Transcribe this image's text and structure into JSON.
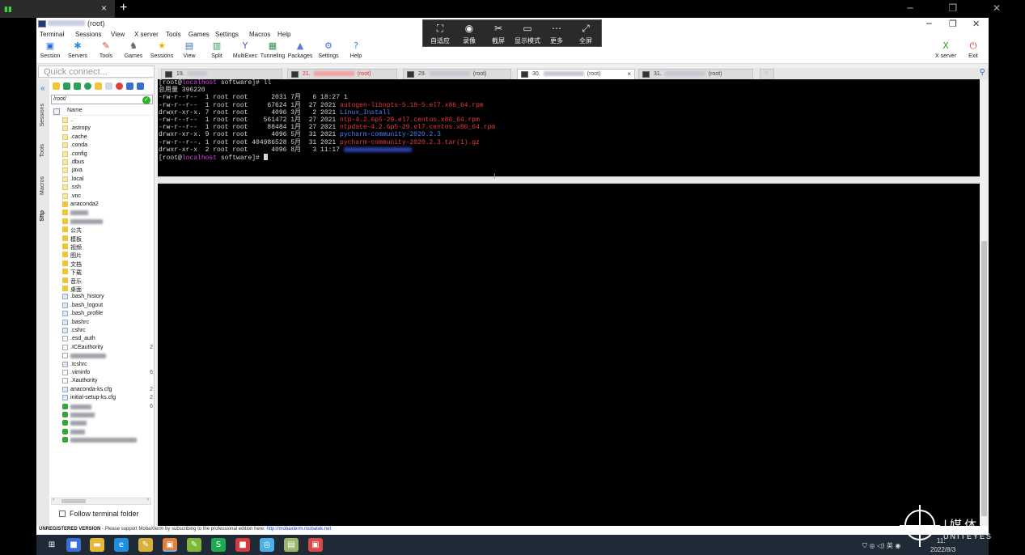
{
  "outer_tab": {
    "title": "",
    "close": "×",
    "plus": "+"
  },
  "outer_controls": "─ ❐ ✕",
  "window": {
    "title_suffix": "(root)",
    "controls": {
      "minimize": "─",
      "maximize": "❐",
      "close": "✕"
    }
  },
  "menu": [
    "Terminal",
    "Sessions",
    "View",
    "X server",
    "Tools",
    "Games",
    "Settings",
    "Macros",
    "Help"
  ],
  "toolbar": [
    {
      "label": "Session",
      "icon": "session-icon",
      "glyph": "▣",
      "color": "#2b6fd6"
    },
    {
      "label": "Servers",
      "icon": "servers-icon",
      "glyph": "✱",
      "color": "#2a8fd8"
    },
    {
      "label": "Tools",
      "icon": "tools-icon",
      "glyph": "✎",
      "color": "#d23b3b"
    },
    {
      "label": "Games",
      "icon": "games-icon",
      "glyph": "♞",
      "color": "#666666"
    },
    {
      "label": "Sessions",
      "icon": "star-icon",
      "glyph": "★",
      "color": "#f0b400"
    },
    {
      "label": "View",
      "icon": "view-icon",
      "glyph": "▤",
      "color": "#3a6fb0"
    },
    {
      "label": "Split",
      "icon": "split-icon",
      "glyph": "▥",
      "color": "#2f9b5a"
    },
    {
      "label": "MultiExec",
      "icon": "multiexec-icon",
      "glyph": "Y",
      "color": "#5a4fc8"
    },
    {
      "label": "Tunneling",
      "icon": "tunneling-icon",
      "glyph": "▦",
      "color": "#2f8f4f"
    },
    {
      "label": "Packages",
      "icon": "packages-icon",
      "glyph": "▲",
      "color": "#5d7ad8"
    },
    {
      "label": "Settings",
      "icon": "settings-icon",
      "glyph": "⚙",
      "color": "#4d6fd0"
    },
    {
      "label": "Help",
      "icon": "help-icon",
      "glyph": "?",
      "color": "#1f8ee8"
    }
  ],
  "toolbar_right": [
    {
      "label": "X server",
      "icon": "xserver-icon",
      "glyph": "X",
      "color": "#2f9b2f"
    },
    {
      "label": "Exit",
      "icon": "power-icon",
      "glyph": "⏻",
      "color": "#e02a2a"
    }
  ],
  "rdp_float": [
    {
      "label": "自适应",
      "icon": "fit-icon",
      "glyph": "⛶"
    },
    {
      "label": "录像",
      "icon": "record-icon",
      "glyph": "◉"
    },
    {
      "label": "截屏",
      "icon": "scissors-icon",
      "glyph": "✂"
    },
    {
      "label": "显示模式",
      "icon": "display-icon",
      "glyph": "▭"
    },
    {
      "label": "更多",
      "icon": "more-icon",
      "glyph": "⋯"
    },
    {
      "label": "全屏",
      "icon": "fullscreen-icon",
      "glyph": "⤢"
    }
  ],
  "quick_connect_placeholder": "Quick connect...",
  "tabs": [
    {
      "num": "19.",
      "suffix": "",
      "active": false,
      "red": false
    },
    {
      "num": "21.",
      "suffix": "(root)",
      "active": false,
      "red": true
    },
    {
      "num": "29.",
      "suffix": "(root)",
      "active": false,
      "red": false
    },
    {
      "num": "30.",
      "suffix": "(root)",
      "active": true,
      "red": false
    },
    {
      "num": "31.",
      "suffix": "(root)",
      "active": false,
      "red": false
    }
  ],
  "tab_close": "×",
  "side_labels": [
    "Sessions",
    "Tools",
    "Macros",
    "Sftp"
  ],
  "sftp": {
    "path": "/root/",
    "column_name": "Name",
    "items": [
      {
        "name": "..",
        "type": "folder-light",
        "tail": ""
      },
      {
        "name": ".astropy",
        "type": "folder-light",
        "tail": ""
      },
      {
        "name": ".cache",
        "type": "folder-light",
        "tail": ""
      },
      {
        "name": ".conda",
        "type": "folder-light",
        "tail": ""
      },
      {
        "name": ".config",
        "type": "folder-light",
        "tail": ""
      },
      {
        "name": ".dbus",
        "type": "folder-light",
        "tail": ""
      },
      {
        "name": ".java",
        "type": "folder-light",
        "tail": ""
      },
      {
        "name": ".local",
        "type": "folder-light",
        "tail": ""
      },
      {
        "name": ".ssh",
        "type": "folder-light",
        "tail": ""
      },
      {
        "name": ".vnc",
        "type": "folder-light",
        "tail": ""
      },
      {
        "name": "anaconda2",
        "type": "folder",
        "tail": ""
      },
      {
        "name": "",
        "type": "folder",
        "tail": "",
        "blur": 22
      },
      {
        "name": "",
        "type": "folder",
        "tail": "",
        "blur": 40
      },
      {
        "name": "公共",
        "type": "folder",
        "tail": ""
      },
      {
        "name": "模板",
        "type": "folder",
        "tail": ""
      },
      {
        "name": "视频",
        "type": "folder",
        "tail": ""
      },
      {
        "name": "图片",
        "type": "folder",
        "tail": ""
      },
      {
        "name": "文档",
        "type": "folder",
        "tail": ""
      },
      {
        "name": "下载",
        "type": "folder",
        "tail": ""
      },
      {
        "name": "音乐",
        "type": "folder",
        "tail": ""
      },
      {
        "name": "桌面",
        "type": "folder",
        "tail": ""
      },
      {
        "name": ".bash_history",
        "type": "fileblue",
        "tail": ""
      },
      {
        "name": ".bash_logout",
        "type": "fileblue",
        "tail": ""
      },
      {
        "name": ".bash_profile",
        "type": "fileblue",
        "tail": ""
      },
      {
        "name": ".bashrc",
        "type": "fileblue",
        "tail": ""
      },
      {
        "name": ".cshrc",
        "type": "fileblue",
        "tail": ""
      },
      {
        "name": ".esd_auth",
        "type": "file",
        "tail": ""
      },
      {
        "name": ".ICEauthority",
        "type": "file",
        "tail": "2"
      },
      {
        "name": "",
        "type": "file",
        "tail": "",
        "blur": 44
      },
      {
        "name": ".tcshrc",
        "type": "fileblue",
        "tail": ""
      },
      {
        "name": ".viminfo",
        "type": "file",
        "tail": "6"
      },
      {
        "name": ".Xauthority",
        "type": "file",
        "tail": ""
      },
      {
        "name": "anaconda-ks.cfg",
        "type": "fileblue",
        "tail": "2"
      },
      {
        "name": "initial-setup-ks.cfg",
        "type": "fileblue",
        "tail": "2"
      },
      {
        "name": "",
        "type": "py",
        "tail": "6",
        "blur": 26
      },
      {
        "name": "",
        "type": "py",
        "tail": "",
        "blur": 30
      },
      {
        "name": "",
        "type": "py",
        "tail": "",
        "blur": 20
      },
      {
        "name": "",
        "type": "py",
        "tail": "",
        "blur": 18
      },
      {
        "name": "",
        "type": "py",
        "tail": "",
        "blur": 82
      }
    ],
    "follow_label": "Follow terminal folder"
  },
  "terminal": {
    "lines": [
      {
        "parts": [
          [
            "plain",
            "[root@"
          ],
          [
            "mag",
            "localhost"
          ],
          [
            "plain",
            " software]# ll"
          ]
        ]
      },
      {
        "parts": [
          [
            "plain",
            "总用量 396220"
          ]
        ]
      },
      {
        "parts": [
          [
            "plain",
            "-rw-r--r--  1 root root      2031 7月   6 18:27 1"
          ]
        ]
      },
      {
        "parts": [
          [
            "plain",
            "-rw-r--r--  1 root root     67624 1月  27 2021 "
          ],
          [
            "red",
            "autogen-libopts-5.18-5.el7.x86_64.rpm"
          ]
        ]
      },
      {
        "parts": [
          [
            "plain",
            "drwxr-xr-x. 7 root root      4096 3月   2 2021 "
          ],
          [
            "blu",
            "Linux_Install"
          ]
        ]
      },
      {
        "parts": [
          [
            "plain",
            "-rw-r--r--  1 root root    561472 1月  27 2021 "
          ],
          [
            "red",
            "ntp-4.2.6p5-29.el7.centos.x86_64.rpm"
          ]
        ]
      },
      {
        "parts": [
          [
            "plain",
            "-rw-r--r--  1 root root     88484 1月  27 2021 "
          ],
          [
            "red",
            "ntpdate-4.2.6p5-29.el7.centos.x86_64.rpm"
          ]
        ]
      },
      {
        "parts": [
          [
            "plain",
            "drwxr-xr-x. 9 root root      4096 5月  31 2021 "
          ],
          [
            "blu",
            "pycharm-community-2020.2.3"
          ]
        ]
      },
      {
        "parts": [
          [
            "plain",
            "-rw-r--r--. 1 root root 404986528 5月  31 2021 "
          ],
          [
            "red",
            "pycharm-community-2020.2.3.tar(1).gz"
          ]
        ]
      },
      {
        "parts": [
          [
            "plain",
            "drwxr-xr-x  2 root root      4096 8月   3 11:17 "
          ],
          [
            "blurtxt",
            ""
          ]
        ]
      },
      {
        "parts": [
          [
            "plain",
            "[root@"
          ],
          [
            "mag",
            "localhost"
          ],
          [
            "plain",
            " software]# "
          ],
          [
            "cursor",
            ""
          ]
        ]
      }
    ]
  },
  "status": {
    "bold": "UNREGISTERED VERSION",
    "text": " -  Please support MobaXterm by subscribing to the professional edition here: ",
    "link": "http://mobaxterm.mobatek.net"
  },
  "taskbar": [
    {
      "glyph": "⊞",
      "color": "#1f2a36",
      "icon": "windows-start-icon",
      "active": false
    },
    {
      "glyph": "■",
      "color": "#3b6fd8",
      "icon": "app-icon",
      "active": false
    },
    {
      "glyph": "▬",
      "color": "#e8b838",
      "icon": "explorer-icon",
      "active": false
    },
    {
      "glyph": "e",
      "color": "#1e8ee0",
      "icon": "edge-icon",
      "active": false
    },
    {
      "glyph": "✎",
      "color": "#d8b03a",
      "icon": "notepad-icon",
      "active": false
    },
    {
      "glyph": "▣",
      "color": "#e0803a",
      "icon": "mobaxterm-icon",
      "active": true
    },
    {
      "glyph": "✎",
      "color": "#7fb83a",
      "icon": "editor-icon",
      "active": false
    },
    {
      "glyph": "S",
      "color": "#1eaa4e",
      "icon": "spreadsheet-icon",
      "active": false
    },
    {
      "glyph": "■",
      "color": "#d83a3a",
      "icon": "slides-icon",
      "active": false
    },
    {
      "glyph": "◎",
      "color": "#4ab0e8",
      "icon": "browser-icon",
      "active": false
    },
    {
      "glyph": "▤",
      "color": "#9ab86a",
      "icon": "tool-icon",
      "active": false
    },
    {
      "glyph": "▣",
      "color": "#d84a4a",
      "icon": "remote-icon",
      "active": false
    }
  ],
  "tray": {
    "icons": "⛉ ◎ ◁) 英 ◉",
    "time": "11:",
    "date": "2022/8/3"
  },
  "watermark": {
    "line1": "|媒体",
    "line2": "UNITEYES"
  }
}
